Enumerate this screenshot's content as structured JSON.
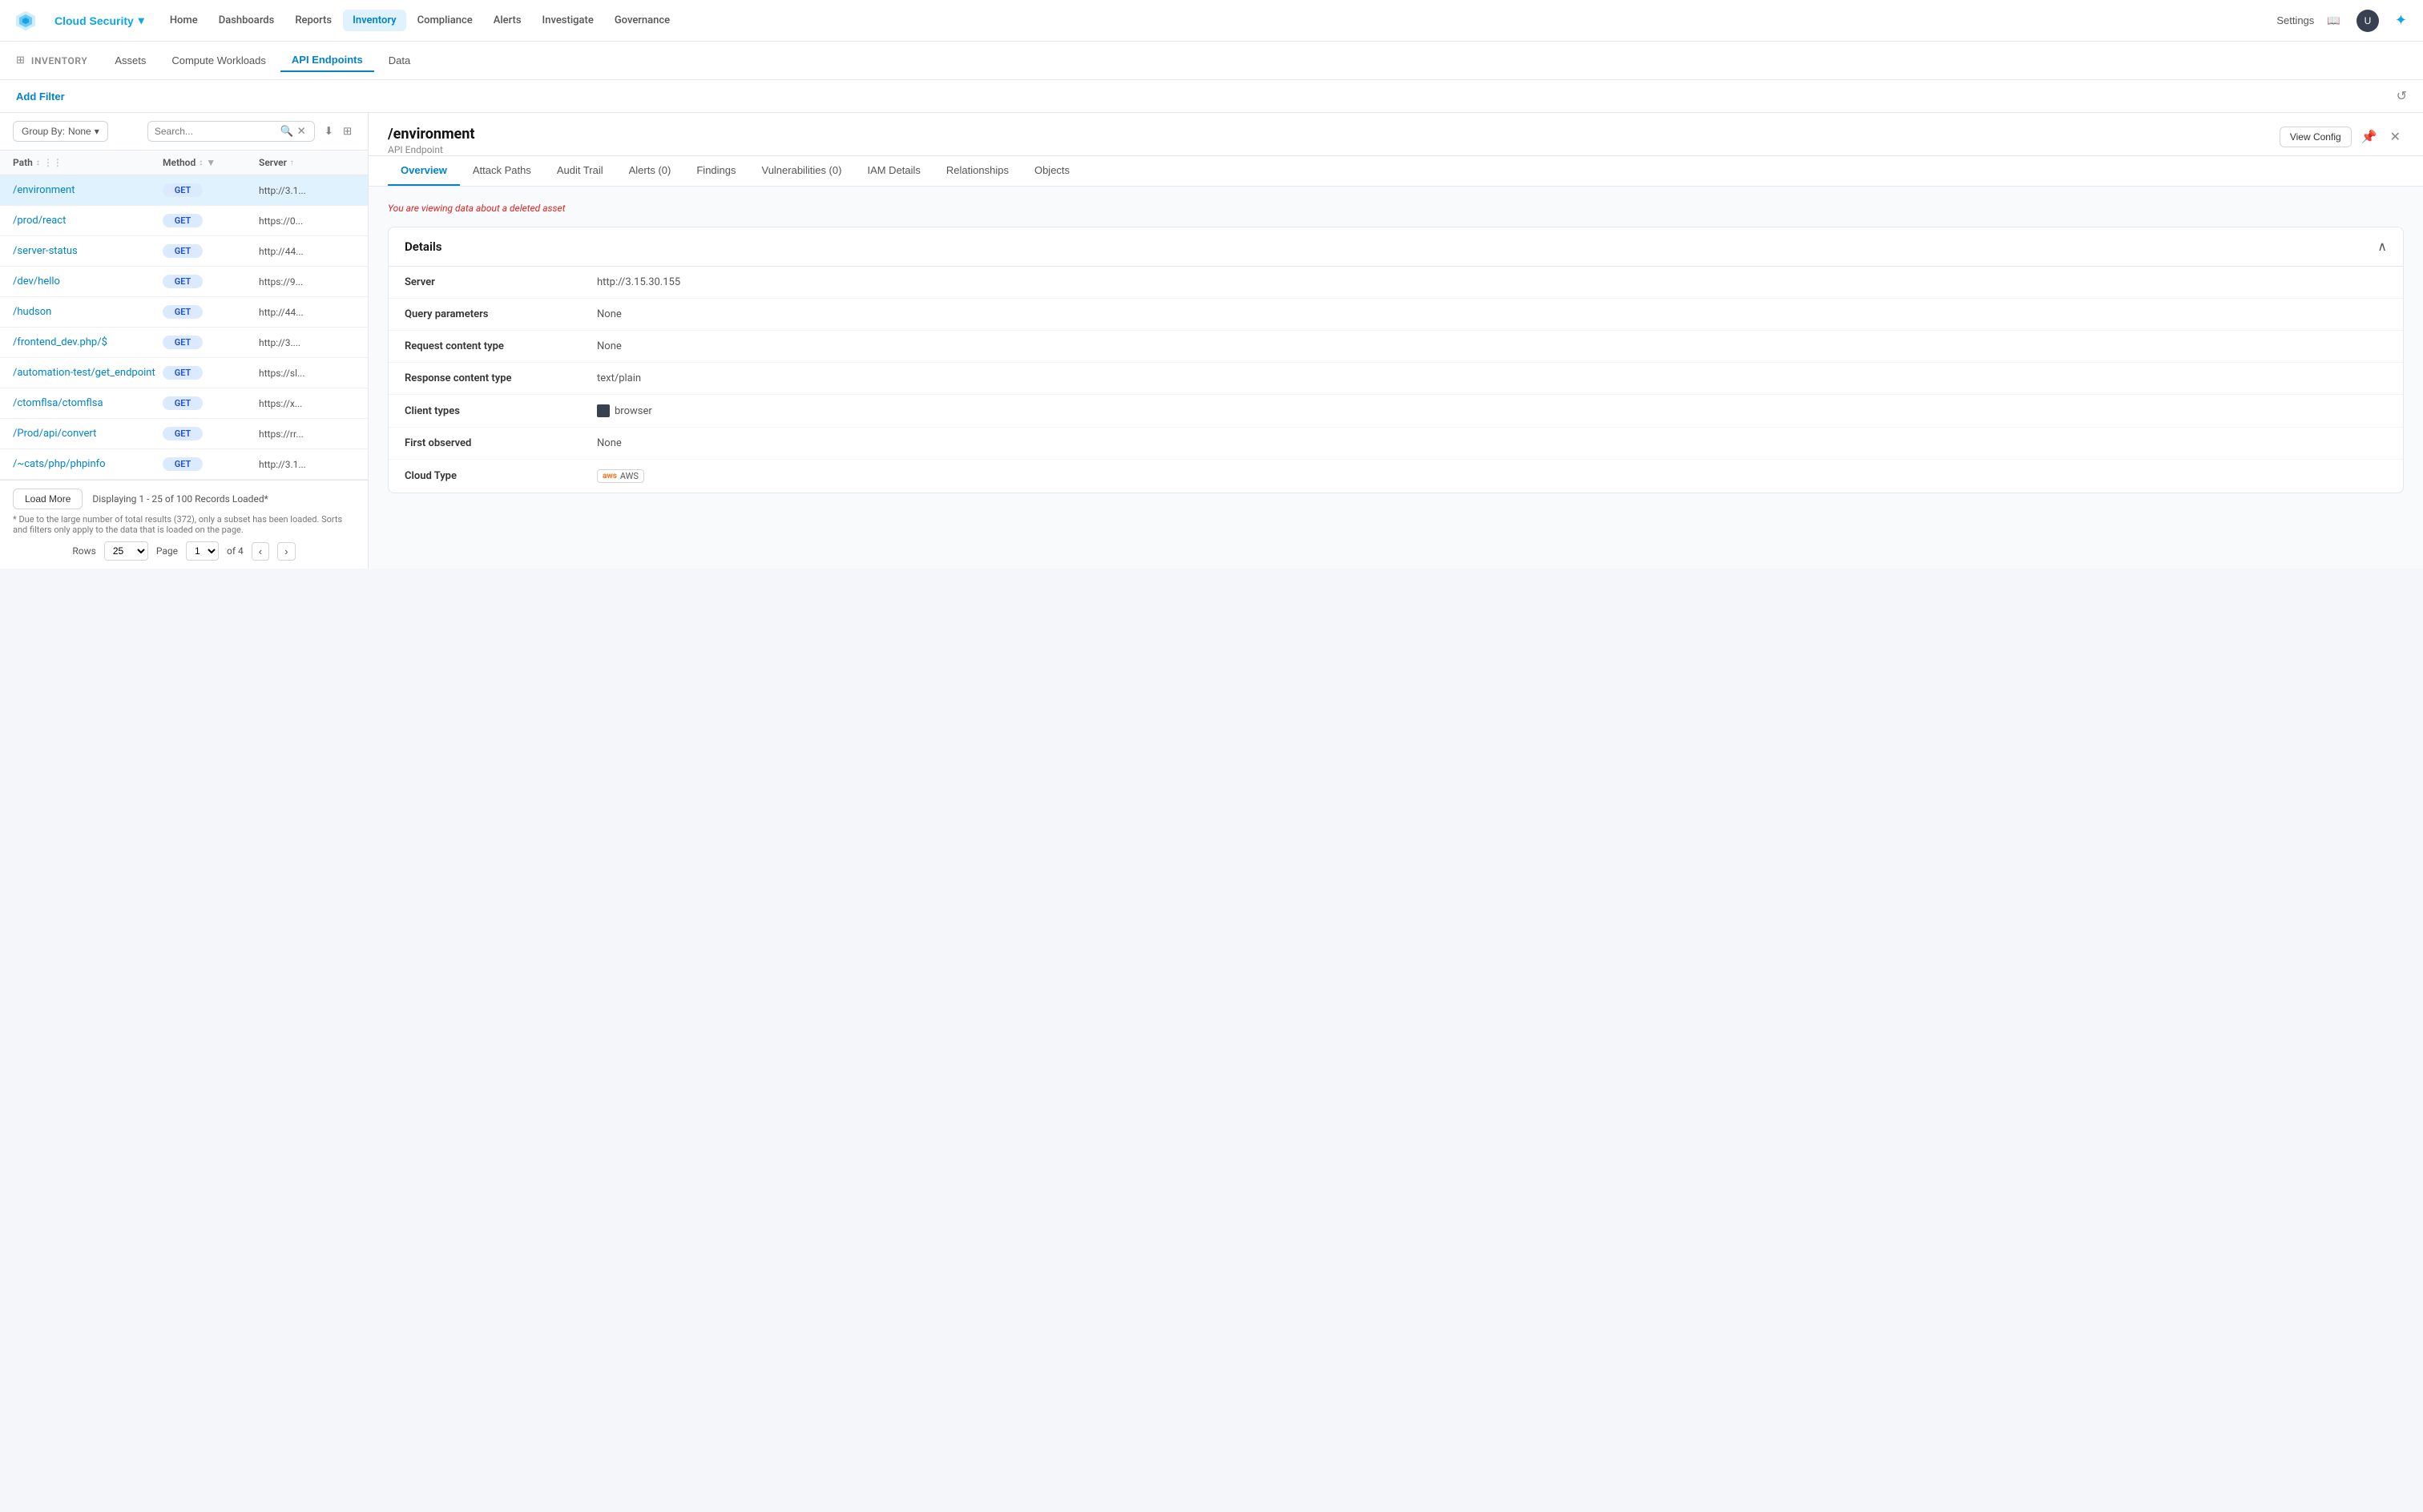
{
  "app": {
    "logo_color": "#0ea5e9",
    "brand_label": "Cloud Security",
    "brand_dropdown_icon": "▾"
  },
  "top_nav": {
    "items": [
      {
        "id": "home",
        "label": "Home",
        "active": false
      },
      {
        "id": "dashboards",
        "label": "Dashboards",
        "active": false
      },
      {
        "id": "reports",
        "label": "Reports",
        "active": false
      },
      {
        "id": "inventory",
        "label": "Inventory",
        "active": true
      },
      {
        "id": "compliance",
        "label": "Compliance",
        "active": false
      },
      {
        "id": "alerts",
        "label": "Alerts",
        "active": false
      },
      {
        "id": "investigate",
        "label": "Investigate",
        "active": false
      },
      {
        "id": "governance",
        "label": "Governance",
        "active": false
      }
    ],
    "right": {
      "settings_label": "Settings",
      "book_icon": "📖",
      "user_icon": "👤",
      "ai_icon": "✦"
    }
  },
  "sub_nav": {
    "icon": "🖥",
    "title": "INVENTORY",
    "tabs": [
      {
        "id": "assets",
        "label": "Assets",
        "active": false
      },
      {
        "id": "compute",
        "label": "Compute Workloads",
        "active": false
      },
      {
        "id": "api",
        "label": "API Endpoints",
        "active": true
      },
      {
        "id": "data",
        "label": "Data",
        "active": false
      }
    ]
  },
  "filter_bar": {
    "add_filter_label": "Add Filter",
    "reset_icon": "↺"
  },
  "left_panel": {
    "group_by_label": "Group By:",
    "group_by_value": "None",
    "group_by_icon": "▾",
    "search_placeholder": "Search...",
    "columns": [
      {
        "id": "path",
        "label": "Path",
        "sortable": true
      },
      {
        "id": "method",
        "label": "Method",
        "sortable": true
      },
      {
        "id": "server",
        "label": "Server",
        "sortable": true
      }
    ],
    "rows": [
      {
        "path": "/environment",
        "method": "GET",
        "server": "http://3.1...",
        "selected": true
      },
      {
        "path": "/prod/react",
        "method": "GET",
        "server": "https://0...",
        "selected": false
      },
      {
        "path": "/server-status",
        "method": "GET",
        "server": "http://44...",
        "selected": false
      },
      {
        "path": "/dev/hello",
        "method": "GET",
        "server": "https://9...",
        "selected": false
      },
      {
        "path": "/hudson",
        "method": "GET",
        "server": "http://44...",
        "selected": false
      },
      {
        "path": "/frontend_dev.php/$",
        "method": "GET",
        "server": "http://3....",
        "selected": false
      },
      {
        "path": "/automation-test/get_endpoint",
        "method": "GET",
        "server": "https://sl...",
        "selected": false
      },
      {
        "path": "/ctomflsa/ctomflsa",
        "method": "GET",
        "server": "https://x...",
        "selected": false
      },
      {
        "path": "/Prod/api/convert",
        "method": "GET",
        "server": "https://rr...",
        "selected": false
      },
      {
        "path": "/~cats/php/phpinfo",
        "method": "GET",
        "server": "http://3.1...",
        "selected": false
      }
    ],
    "load_more_label": "Load More",
    "records_text": "Displaying 1 - 25 of 100 Records Loaded*",
    "note_text": "* Due to the large number of total results (372), only a subset has been loaded. Sorts and filters only apply to the data that is loaded on the page.",
    "pagination": {
      "rows_label": "Rows",
      "rows_value": "25",
      "page_label": "Page",
      "page_value": "1",
      "of_label": "of 4",
      "prev_icon": "‹",
      "next_icon": "›"
    }
  },
  "right_panel": {
    "endpoint_title": "/environment",
    "endpoint_subtitle": "API Endpoint",
    "view_config_label": "View Config",
    "pin_icon": "📌",
    "close_icon": "✕",
    "tabs": [
      {
        "id": "overview",
        "label": "Overview",
        "active": true
      },
      {
        "id": "attack-paths",
        "label": "Attack Paths",
        "active": false
      },
      {
        "id": "audit-trail",
        "label": "Audit Trail",
        "active": false
      },
      {
        "id": "alerts",
        "label": "Alerts (0)",
        "active": false
      },
      {
        "id": "findings",
        "label": "Findings",
        "active": false
      },
      {
        "id": "vulnerabilities",
        "label": "Vulnerabilities (0)",
        "active": false
      },
      {
        "id": "iam-details",
        "label": "IAM Details",
        "active": false
      },
      {
        "id": "relationships",
        "label": "Relationships",
        "active": false
      },
      {
        "id": "objects",
        "label": "Objects",
        "active": false
      }
    ],
    "deleted_warning": "You are viewing data about a deleted asset",
    "details_section": {
      "title": "Details",
      "collapse_icon": "∧",
      "rows": [
        {
          "label": "Server",
          "value": "http://3.15.30.155",
          "type": "text"
        },
        {
          "label": "Query parameters",
          "value": "None",
          "type": "text"
        },
        {
          "label": "Request content type",
          "value": "None",
          "type": "text"
        },
        {
          "label": "Response content type",
          "value": "text/plain",
          "type": "text"
        },
        {
          "label": "Client types",
          "value": "browser",
          "type": "client"
        },
        {
          "label": "First observed",
          "value": "None",
          "type": "text"
        },
        {
          "label": "Cloud Type",
          "value": "AWS",
          "type": "aws"
        }
      ]
    }
  }
}
